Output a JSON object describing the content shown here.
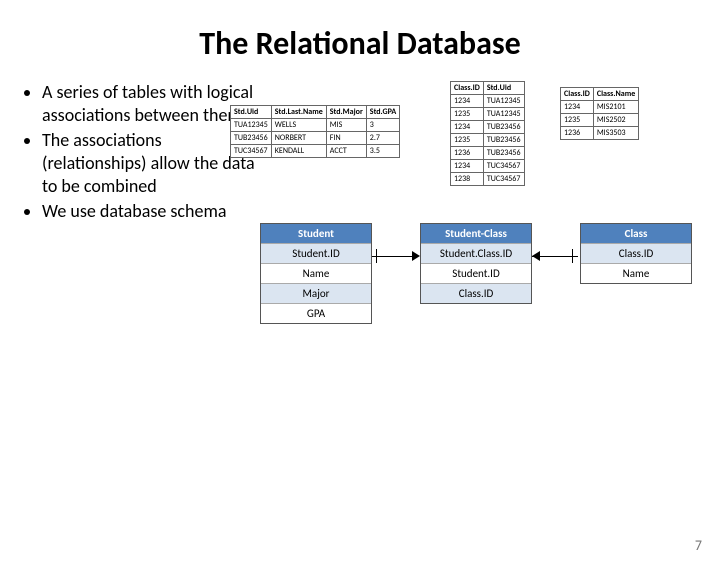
{
  "title": "The Relational Database",
  "bullets": [
    "A series of tables with logical associations between them",
    "The associations (relationships) allow the data to be combined",
    "We use database schema"
  ],
  "studentTable": {
    "headers": [
      "Std.Uid",
      "Std.Last.Name",
      "Std.Major",
      "Std.GPA"
    ],
    "rows": [
      [
        "TUA12345",
        "WELLS",
        "MIS",
        "3"
      ],
      [
        "TUB23456",
        "NORBERT",
        "FIN",
        "2.7"
      ],
      [
        "TUC34567",
        "KENDALL",
        "ACCT",
        "3.5"
      ]
    ]
  },
  "studentClassTable": {
    "headers": [
      "Class.ID",
      "Std.Uid"
    ],
    "rows": [
      [
        "1234",
        "TUA12345"
      ],
      [
        "1235",
        "TUA12345"
      ],
      [
        "1234",
        "TUB23456"
      ],
      [
        "1235",
        "TUB23456"
      ],
      [
        "1236",
        "TUB23456"
      ],
      [
        "1234",
        "TUC34567"
      ],
      [
        "1238",
        "TUC34567"
      ]
    ]
  },
  "classTable": {
    "headers": [
      "Class.ID",
      "Class.Name"
    ],
    "rows": [
      [
        "1234",
        "MIS2101"
      ],
      [
        "1235",
        "MIS2502"
      ],
      [
        "1236",
        "MIS3503"
      ]
    ]
  },
  "schemas": {
    "student": {
      "title": "Student",
      "rows": [
        "Student.ID",
        "Name",
        "Major",
        "GPA"
      ]
    },
    "studentClass": {
      "title": "Student-Class",
      "rows": [
        "Student.Class.ID",
        "Student.ID",
        "Class.ID"
      ]
    },
    "class": {
      "title": "Class",
      "rows": [
        "Class.ID",
        "Name"
      ]
    }
  },
  "pageNumber": "7"
}
